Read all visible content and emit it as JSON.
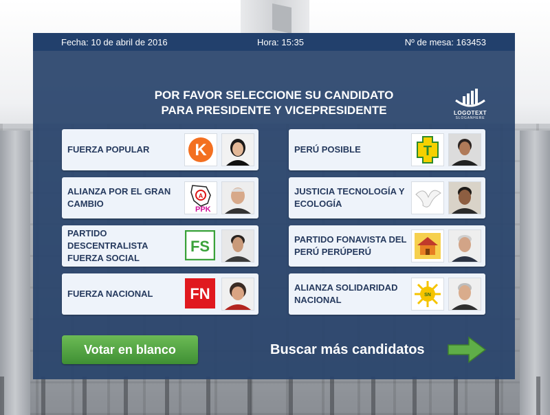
{
  "header": {
    "date": "Fecha: 10 de abril de 2016",
    "time": "Hora: 15:35",
    "table": "Nº de mesa: 163453"
  },
  "logo": {
    "text": "LOGOTEXT",
    "slogan": "SLOGANHERE"
  },
  "title": {
    "line1": "POR FAVOR SELECCIONE SU CANDIDATO",
    "line2": "PARA PRESIDENTE Y VICEPRESIDENTE"
  },
  "candidates": [
    {
      "party": "FUERZA POPULAR",
      "logo_icon": "k-circle-logo"
    },
    {
      "party": "PERÚ POSIBLE",
      "logo_icon": "chakana-logo"
    },
    {
      "party": "ALIANZA POR EL GRAN CAMBIO",
      "logo_icon": "peru-map-logo",
      "logo_text": "PPK"
    },
    {
      "party": "JUSTICIA TECNOLOGÍA Y ECOLOGÍA",
      "logo_icon": "dove-logo"
    },
    {
      "party": "PARTIDO DESCENTRALISTA FUERZA SOCIAL",
      "logo_icon": "fs-logo",
      "logo_text": "FS"
    },
    {
      "party": "PARTIDO FONAVISTA DEL PERÚ PERÚPERÚ",
      "logo_icon": "house-logo"
    },
    {
      "party": "FUERZA NACIONAL",
      "logo_icon": "fn-logo",
      "logo_text": "FN"
    },
    {
      "party": "ALIANZA SOLIDARIDAD NACIONAL",
      "logo_icon": "sun-logo"
    }
  ],
  "buttons": {
    "blank_vote": "Votar en blanco",
    "more_candidates": "Buscar más candidatos"
  },
  "colors": {
    "panel": "#29446c",
    "topbar": "#22406c",
    "card": "#eef3fa",
    "party_text": "#263a5e",
    "accent_green": "#4e9f3d"
  }
}
